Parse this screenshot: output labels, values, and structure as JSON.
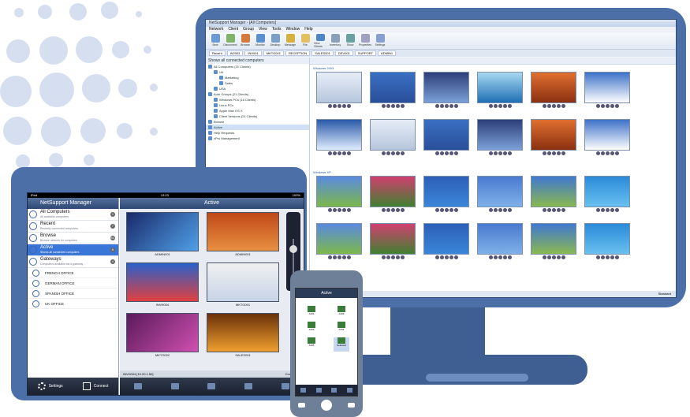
{
  "tablet": {
    "status": {
      "carrier": "iPad",
      "time": "13:23",
      "battery": "100%"
    },
    "sidebar_title": "NetSupport Manager",
    "main_title": "Active",
    "items": [
      {
        "label": "All Computers",
        "sub": "All available computers",
        "badge": "1"
      },
      {
        "label": "Recent",
        "sub": "Recently connected computers",
        "badge": "7"
      },
      {
        "label": "Browse",
        "sub": "Browse network for computers",
        "badge": "64"
      },
      {
        "label": "Active",
        "sub": "Shows all connected computers",
        "badge": "6"
      },
      {
        "label": "Gateways",
        "sub": "Computers available via a gateway",
        "badge": "4"
      }
    ],
    "offices": [
      "FRENCH OFFICE",
      "GERMAN OFFICE",
      "SPANISH OFFICE",
      "UK OFFICE"
    ],
    "settings_label": "Settings",
    "connect_label": "Connect",
    "thumbs": [
      "ADMIN001",
      "ADMIN001",
      "INVH004",
      "MKTG001",
      "MKTG002",
      "SALES001"
    ],
    "status_left": "INVH004 [10.20.1.50]",
    "status_right": "Connected"
  },
  "monitor": {
    "title": "NetSupport Manager - [All Computers]",
    "menu": [
      "Network",
      "Client",
      "Group",
      "View",
      "Tools",
      "Window",
      "Help"
    ],
    "toolbar": [
      "New",
      "Disconnect",
      "Browse",
      "Monitor",
      "Desktop",
      "Message",
      "File",
      "View Clients",
      "Inventory",
      "Show",
      "Properties",
      "Settings"
    ],
    "tabs": [
      "Recent",
      "W2003",
      "INV001",
      "MKTG001",
      "RECEPTION",
      "SALES001",
      "DEV001",
      "SUPPORT",
      "ADMIN1"
    ],
    "tree_title": "Shows all connected computers",
    "tree": [
      {
        "label": "All Computers (21 Clients)",
        "indent": 0
      },
      {
        "label": "UK",
        "indent": 1
      },
      {
        "label": "Marketing",
        "indent": 2
      },
      {
        "label": "Sales",
        "indent": 2
      },
      {
        "label": "USA",
        "indent": 1
      },
      {
        "label": "Auto Groups (21 Clients)",
        "indent": 0
      },
      {
        "label": "Windows PCs (16 Clients)",
        "indent": 1
      },
      {
        "label": "Linux PCs",
        "indent": 1
      },
      {
        "label": "Apple Mac OS X",
        "indent": 1
      },
      {
        "label": "Client Versions (21 Clients)",
        "indent": 1
      },
      {
        "label": "Browse",
        "indent": 0
      },
      {
        "label": "Active",
        "indent": 0
      },
      {
        "label": "Help Requests",
        "indent": 0
      },
      {
        "label": "vPro Management",
        "indent": 0
      }
    ],
    "groups": [
      "Windows 2003",
      "Windows XP"
    ],
    "status": "Standard"
  },
  "phone": {
    "title": "Active",
    "tiles": [
      "AJ01",
      "AJ02",
      "AJ03",
      "AJ04",
      "AJ05",
      "Selected"
    ],
    "status": "INVH004 [10.20.1.50]"
  }
}
